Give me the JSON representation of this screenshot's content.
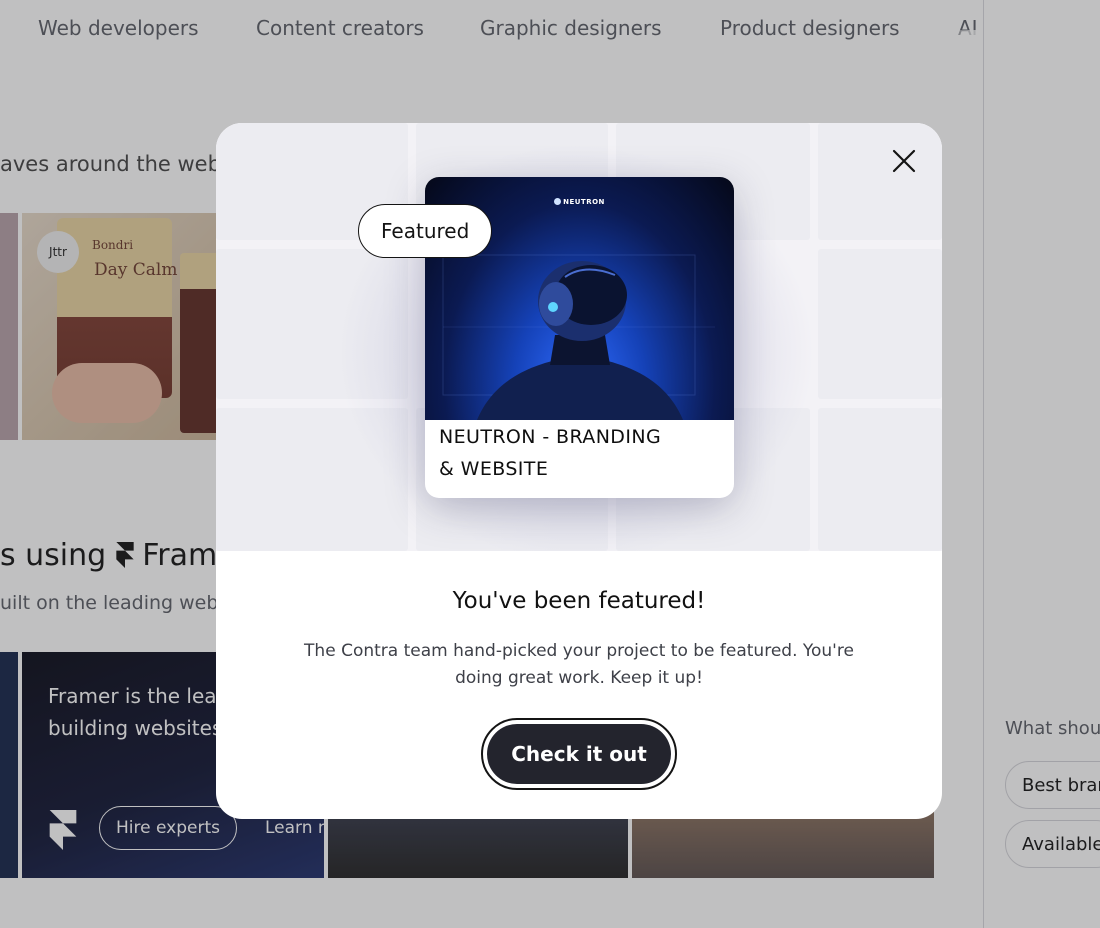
{
  "category_nav": {
    "items": [
      "Web developers",
      "Content creators",
      "Graphic designers",
      "Product designers",
      "AI"
    ]
  },
  "web_section": {
    "title_partial": "aves around the web",
    "badge": "Jttr",
    "product_brand": "Bondri",
    "product_name": "Day Calm"
  },
  "framer_section": {
    "title_prefix": "s using",
    "title_brand": "Frame",
    "subtitle": "uilt on the leading web",
    "card_text": "Framer is the lea tool for building websites, fast",
    "hire_button": "Hire experts",
    "learn_link": "Learn m"
  },
  "sidebar": {
    "question": "What shou",
    "chips": [
      "Best bran",
      "Available"
    ]
  },
  "modal": {
    "badge": "Featured",
    "project_brand": "NEUTRON",
    "project_title_line1": "NEUTRON - BRANDING",
    "project_title_line2": "& WEBSITE",
    "heading": "You've been featured!",
    "body": "The Contra team hand-picked your project to be featured. You're doing great work. Keep it up!",
    "cta": "Check it out"
  },
  "colors": {
    "overlay": "#2d2d32",
    "cta_bg": "#23242d",
    "modal_bg": "#ffffff",
    "modal_top_bg": "#f3f2f6"
  },
  "icons": {
    "close": "close-icon",
    "framer": "framer-logo-icon"
  }
}
